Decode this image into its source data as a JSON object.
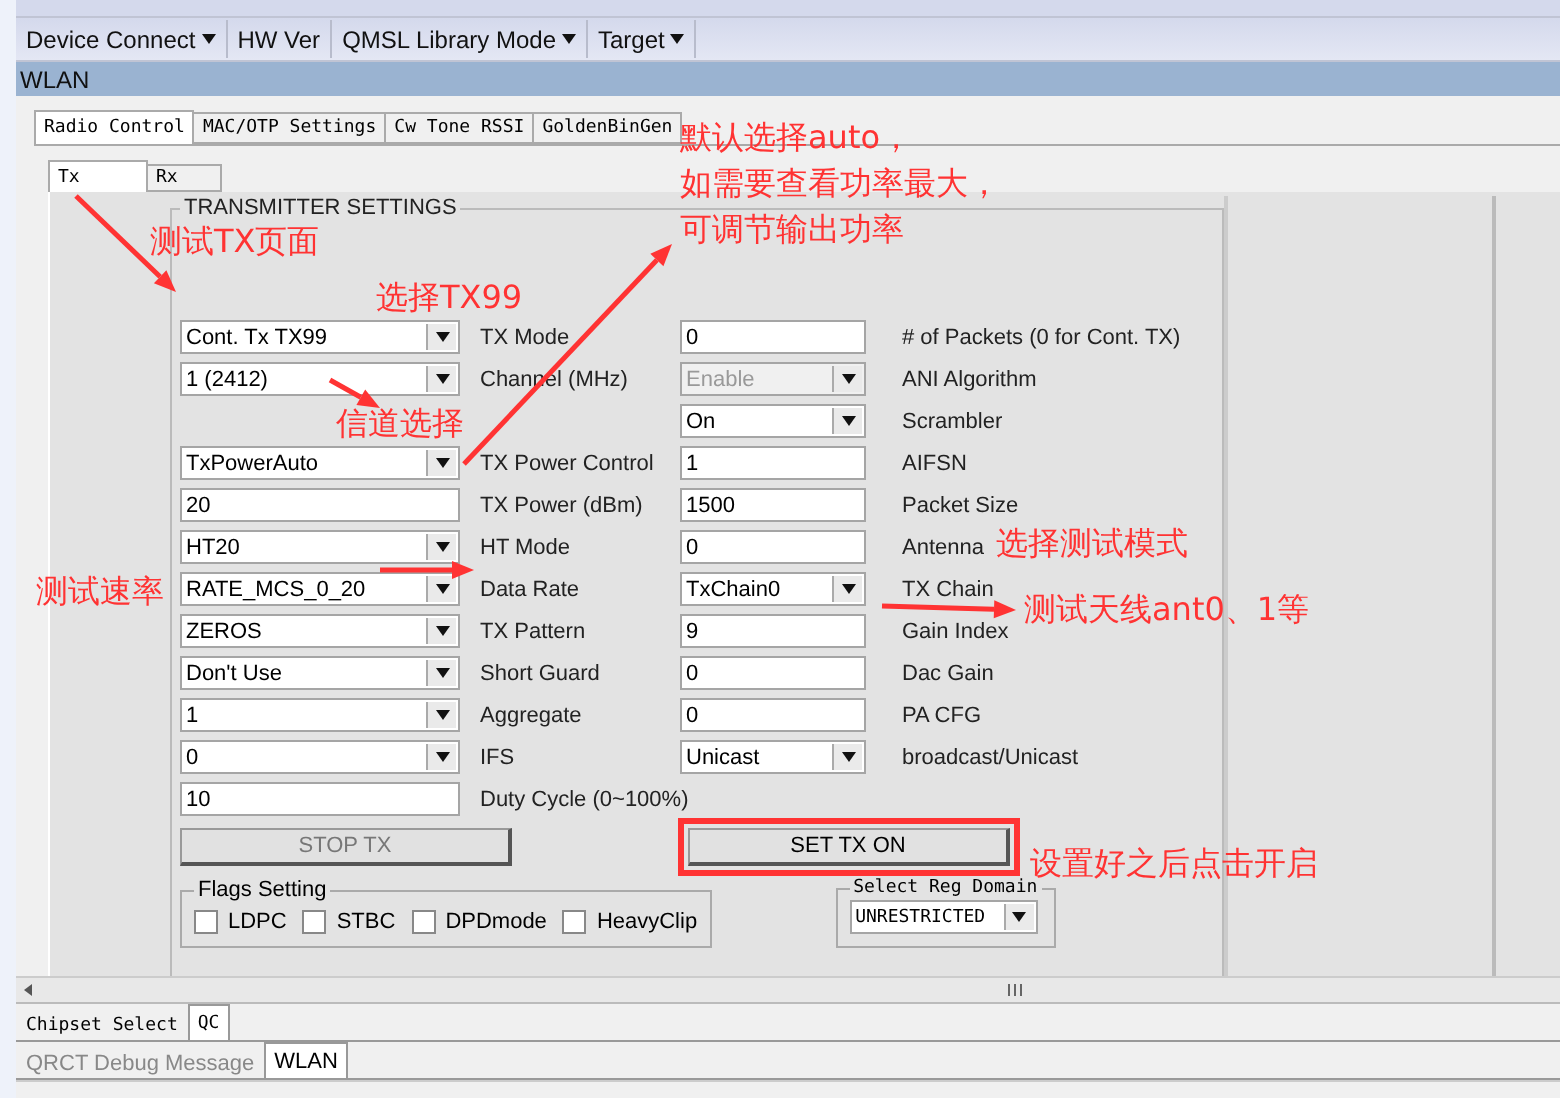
{
  "toolbar": [
    {
      "label": "Device Connect",
      "dropdown": true
    },
    {
      "label": "HW Ver",
      "dropdown": false
    },
    {
      "label": "QMSL Library Mode",
      "dropdown": true
    },
    {
      "label": "Target",
      "dropdown": true
    }
  ],
  "window": {
    "title": "WLAN"
  },
  "tabs": [
    {
      "label": "Radio Control",
      "selected": true
    },
    {
      "label": "MAC/OTP Settings",
      "selected": false
    },
    {
      "label": "Cw Tone RSSI",
      "selected": false
    },
    {
      "label": "GoldenBinGen",
      "selected": false
    }
  ],
  "subtabs": [
    {
      "label": "Tx",
      "selected": true
    },
    {
      "label": "Rx",
      "selected": false
    }
  ],
  "group": {
    "title": "TRANSMITTER SETTINGS"
  },
  "tx_rows": [
    {
      "left": {
        "kind": "dropdown",
        "value": "Cont. Tx TX99",
        "label": "TX Mode"
      },
      "right": {
        "kind": "input",
        "value": "0",
        "label": "# of Packets (0 for Cont. TX)"
      }
    },
    {
      "left": {
        "kind": "dropdown",
        "value": "1 (2412)",
        "label": "Channel (MHz)"
      },
      "right": {
        "kind": "dropdown",
        "value": "Enable",
        "label": "ANI Algorithm",
        "disabled": true
      }
    },
    {
      "left": null,
      "right": {
        "kind": "dropdown",
        "value": "On",
        "label": "Scrambler",
        "disabled": false
      }
    },
    {
      "left": {
        "kind": "dropdown",
        "value": "TxPowerAuto",
        "label": "TX Power Control"
      },
      "right": {
        "kind": "input",
        "value": "1",
        "label": "AIFSN"
      }
    },
    {
      "left": {
        "kind": "input",
        "value": "20",
        "label": "TX Power (dBm)"
      },
      "right": {
        "kind": "input",
        "value": "1500",
        "label": "Packet Size"
      }
    },
    {
      "left": {
        "kind": "dropdown",
        "value": "HT20",
        "label": "HT Mode"
      },
      "right": {
        "kind": "input",
        "value": "0",
        "label": "Antenna"
      }
    },
    {
      "left": {
        "kind": "dropdown",
        "value": "RATE_MCS_0_20",
        "label": "Data Rate"
      },
      "right": {
        "kind": "dropdown",
        "value": "TxChain0",
        "label": "TX Chain",
        "disabled": false
      }
    },
    {
      "left": {
        "kind": "dropdown",
        "value": "ZEROS",
        "label": "TX Pattern"
      },
      "right": {
        "kind": "input",
        "value": "9",
        "label": "Gain Index"
      }
    },
    {
      "left": {
        "kind": "dropdown",
        "value": "Don't Use",
        "label": "Short Guard"
      },
      "right": {
        "kind": "input",
        "value": "0",
        "label": "Dac Gain"
      }
    },
    {
      "left": {
        "kind": "dropdown",
        "value": "1",
        "label": "Aggregate"
      },
      "right": {
        "kind": "input",
        "value": "0",
        "label": "PA CFG"
      }
    },
    {
      "left": {
        "kind": "dropdown",
        "value": "0",
        "label": "IFS"
      },
      "right": {
        "kind": "dropdown",
        "value": "Unicast",
        "label": "broadcast/Unicast",
        "disabled": false
      }
    },
    {
      "left": {
        "kind": "input",
        "value": "10",
        "label": "Duty Cycle (0~100%)"
      },
      "right": null
    }
  ],
  "buttons": [
    {
      "label": "STOP TX",
      "disabled": true,
      "highlighted": false
    },
    {
      "label": "SET TX ON",
      "disabled": false,
      "highlighted": true
    }
  ],
  "flags": {
    "title": "Flags Setting",
    "items": [
      {
        "label": "LDPC",
        "checked": false
      },
      {
        "label": "STBC",
        "checked": false
      },
      {
        "label": "DPDmode",
        "checked": false
      },
      {
        "label": "HeavyClip",
        "checked": false
      }
    ]
  },
  "reg_domain": {
    "title": "Select Reg Domain",
    "value": "UNRESTRICTED"
  },
  "bottom_tabs": [
    {
      "label": "Chipset Select",
      "selected": false
    },
    {
      "label": "QC",
      "selected": true
    }
  ],
  "output_tabs": [
    {
      "label": "QRCT Debug Message",
      "selected": false
    },
    {
      "label": "WLAN",
      "selected": true
    }
  ],
  "annotations": [
    {
      "text": "默认选择auto，"
    },
    {
      "text": "如需要查看功率最大，"
    },
    {
      "text": "测试TX页面"
    },
    {
      "text": "可调节输出功率"
    },
    {
      "text": "选择TX99"
    },
    {
      "text": "信道选择"
    },
    {
      "text": "选择测试模式"
    },
    {
      "text": "测试速率"
    },
    {
      "text": "测试天线ant0、1等"
    },
    {
      "text": "设置好之后点击开启"
    }
  ]
}
